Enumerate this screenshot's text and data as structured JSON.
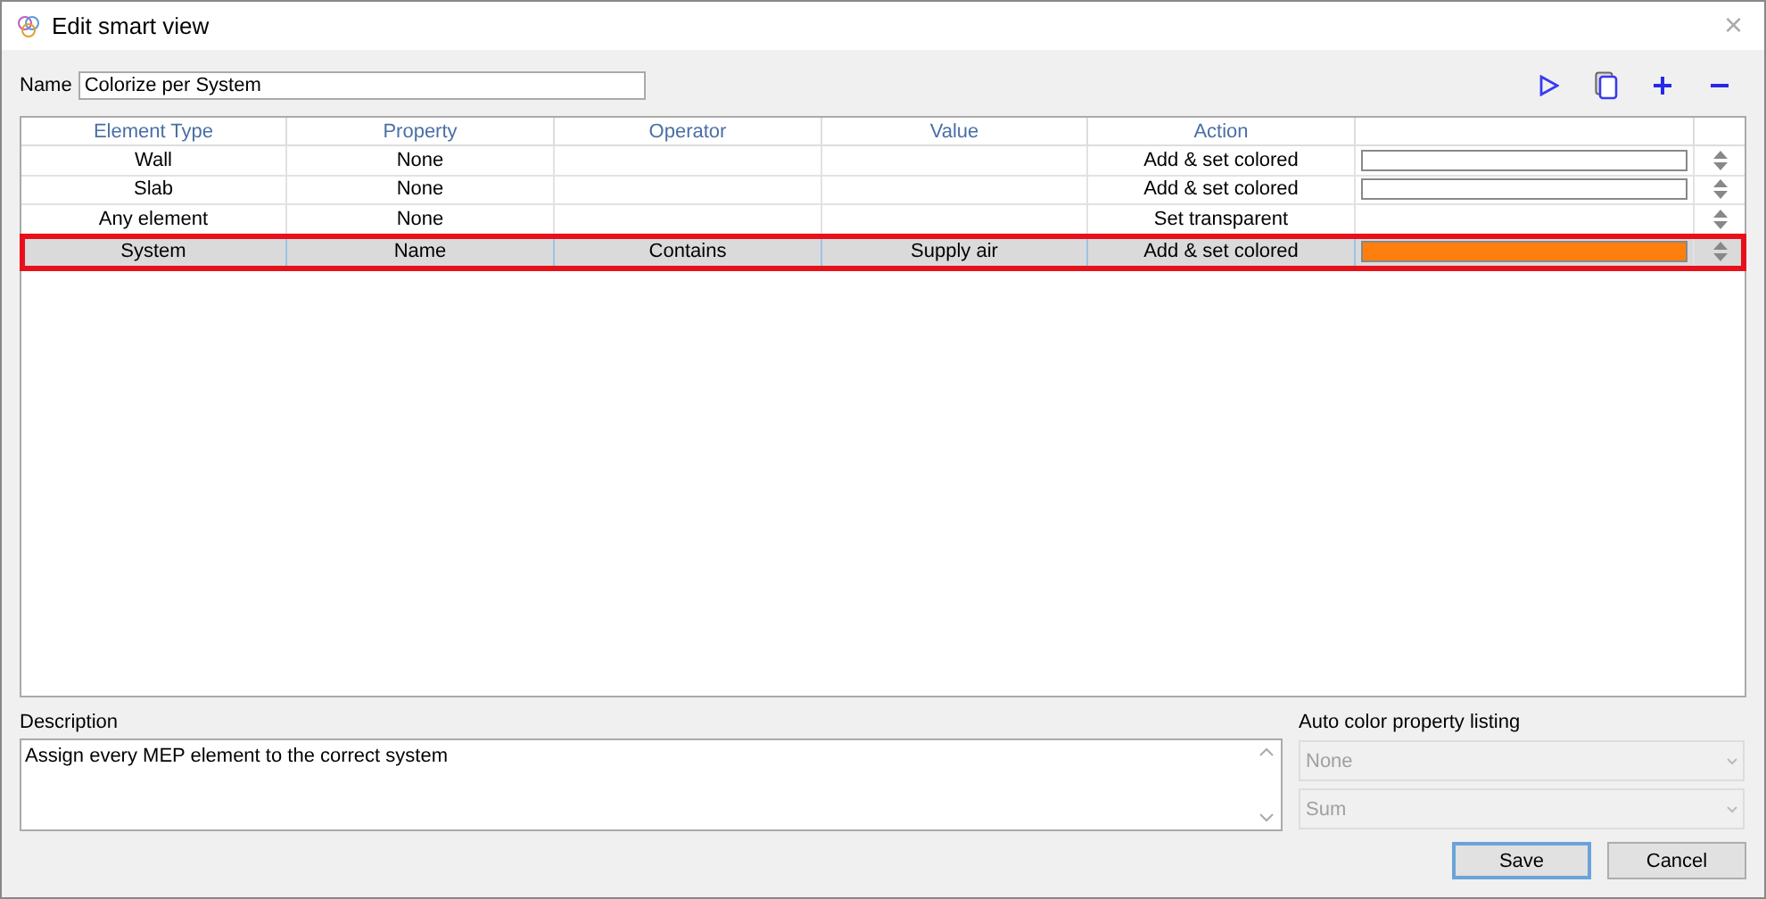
{
  "window": {
    "title": "Edit smart view",
    "close": "×"
  },
  "name_field": {
    "label": "Name",
    "value": "Colorize per System"
  },
  "toolbar": [
    {
      "kind": "play"
    },
    {
      "kind": "copy"
    },
    {
      "kind": "add"
    },
    {
      "kind": "remove"
    }
  ],
  "table": {
    "columns": [
      "Element Type",
      "Property",
      "Operator",
      "Value",
      "Action"
    ],
    "rows": [
      {
        "element_type": "Wall",
        "property": "None",
        "operator": "",
        "value": "",
        "action": "Add & set colored",
        "color": "#ffffff",
        "selected": false
      },
      {
        "element_type": "Slab",
        "property": "None",
        "operator": "",
        "value": "",
        "action": "Add & set colored",
        "color": "#ffffff",
        "selected": false
      },
      {
        "element_type": "Any element",
        "property": "None",
        "operator": "",
        "value": "",
        "action": "Set transparent",
        "selected": false
      },
      {
        "element_type": "System",
        "property": "Name",
        "operator": "Contains",
        "value": "Supply air",
        "action": "Add & set colored",
        "color": "#ff7f0e",
        "selected": true
      }
    ]
  },
  "description": {
    "label": "Description",
    "value": "Assign every MEP element to the correct system"
  },
  "auto_color": {
    "label": "Auto color property listing",
    "selects": [
      {
        "value": "None",
        "disabled": true
      },
      {
        "value": "Sum",
        "disabled": true
      }
    ]
  },
  "buttons": [
    {
      "label": "Save",
      "default": true
    },
    {
      "label": "Cancel",
      "default": false
    }
  ]
}
